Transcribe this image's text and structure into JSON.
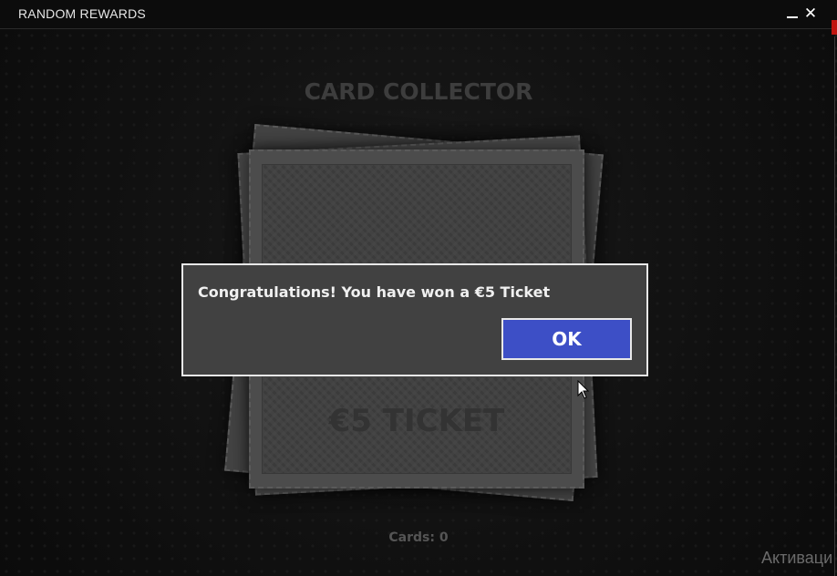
{
  "window": {
    "title": "RANDOM REWARDS",
    "minimize_icon": "minimize-icon",
    "close_icon": "close-icon",
    "close_glyph": "✕"
  },
  "game": {
    "heading": "CARD COLLECTOR",
    "card_label": "€5 TICKET",
    "cards_count": "Cards: 0"
  },
  "dialog": {
    "message": "Congratulations! You have won a €5 Ticket",
    "ok_label": "OK"
  },
  "overlay": {
    "watermark": "Активаци"
  },
  "colors": {
    "ok_button": "#3d4fc6",
    "dialog_bg": "#414141",
    "accent_red": "#c0140f"
  }
}
